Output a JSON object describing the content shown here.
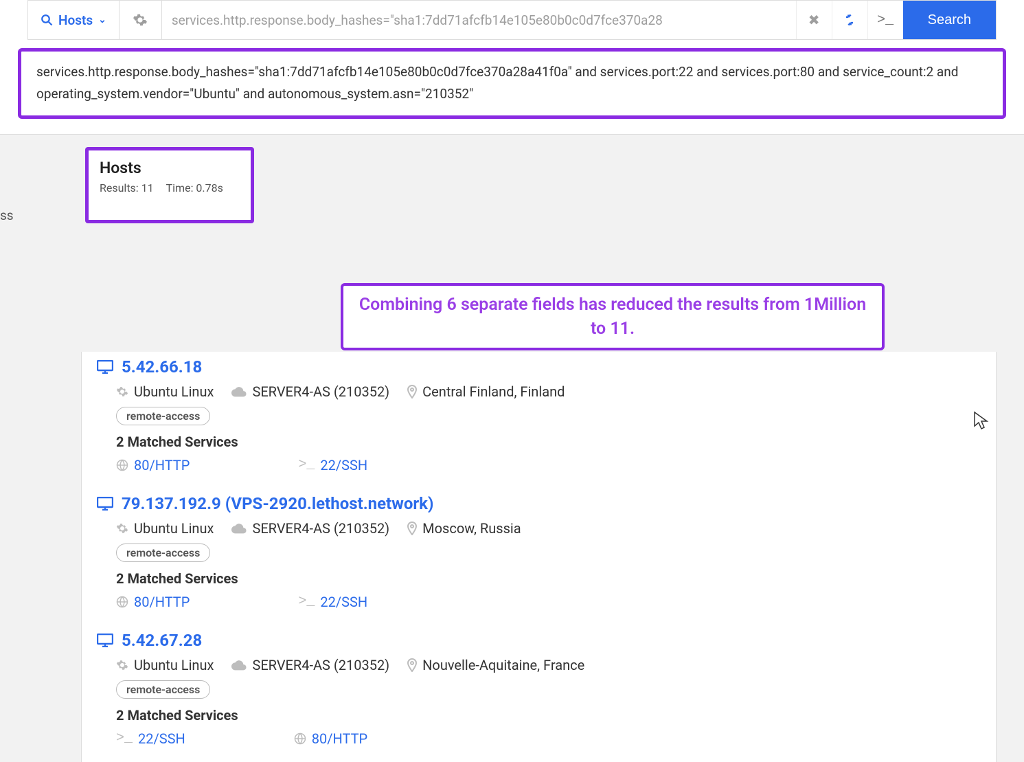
{
  "toolbar": {
    "hosts_label": "Hosts",
    "search_input_text": "services.http.response.body_hashes=\"sha1:7dd71afcfb14e105e80b0c0d7fce370a28",
    "search_button": "Search"
  },
  "expanded_query": "services.http.response.body_hashes=\"sha1:7dd71afcfb14e105e80b0c0d7fce370a28a41f0a\" and services.port:22 and services.port:80 and service_count:2 and operating_system.vendor=\"Ubuntu\" and autonomous_system.asn=\"210352\"",
  "left_stub": "ss",
  "hosts_panel": {
    "heading": "Hosts",
    "results_label": "Results: 11",
    "time_label": "Time: 0.78s"
  },
  "annotation": "Combining 6 separate fields has reduced the results from 1Million to 11.",
  "results": [
    {
      "title": "5.42.66.18",
      "os": "Ubuntu Linux",
      "asn": "SERVER4-AS (210352)",
      "location": "Central Finland, Finland",
      "tag": "remote-access",
      "matched_heading": "2 Matched Services",
      "services": [
        {
          "kind": "http",
          "label": "80/HTTP"
        },
        {
          "kind": "ssh",
          "label": "22/SSH"
        }
      ]
    },
    {
      "title": "79.137.192.9 (VPS-2920.lethost.network)",
      "os": "Ubuntu Linux",
      "asn": "SERVER4-AS (210352)",
      "location": "Moscow, Russia",
      "tag": "remote-access",
      "matched_heading": "2 Matched Services",
      "services": [
        {
          "kind": "http",
          "label": "80/HTTP"
        },
        {
          "kind": "ssh",
          "label": "22/SSH"
        }
      ]
    },
    {
      "title": "5.42.67.28",
      "os": "Ubuntu Linux",
      "asn": "SERVER4-AS (210352)",
      "location": "Nouvelle-Aquitaine, France",
      "tag": "remote-access",
      "matched_heading": "2 Matched Services",
      "services": [
        {
          "kind": "ssh",
          "label": "22/SSH"
        },
        {
          "kind": "http",
          "label": "80/HTTP"
        }
      ]
    }
  ]
}
